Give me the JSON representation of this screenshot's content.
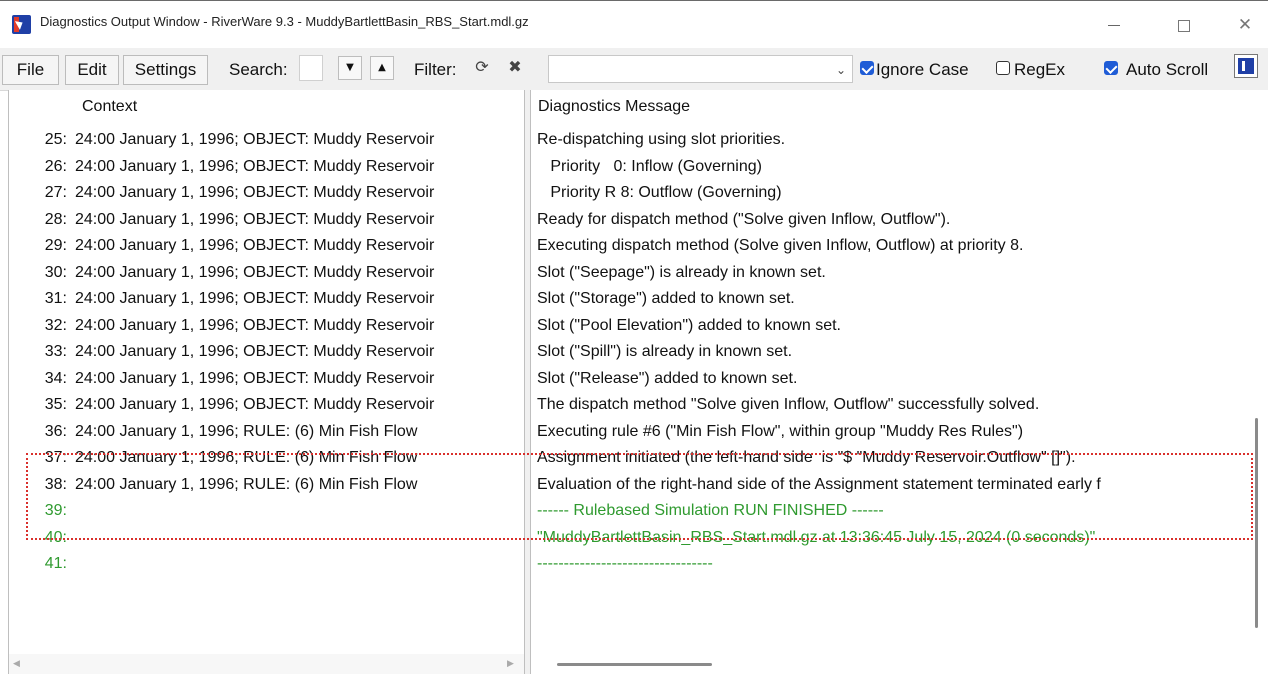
{
  "window": {
    "title": "Diagnostics Output Window - RiverWare 9.3 - MuddyBartlettBasin_RBS_Start.mdl.gz",
    "minimize_glyph": "",
    "maximize_glyph": "",
    "close_glyph": "✕"
  },
  "toolbar": {
    "file_label": "File",
    "edit_label": "Edit",
    "settings_label": "Settings",
    "search_label": "Search:",
    "search_value": "",
    "next_glyph": "▼",
    "prev_glyph": "▲",
    "filter_label": "Filter:",
    "refresh_glyph": "⟳",
    "clear_glyph": "✖",
    "filter_value": "",
    "combo_arrow_glyph": "⌄",
    "ignore_case_label": "Ignore Case",
    "ignore_case_checked": true,
    "regex_label": "RegEx",
    "regex_checked": false,
    "auto_scroll_label": "Auto Scroll",
    "auto_scroll_checked": true
  },
  "columns": {
    "context": "Context",
    "message": "Diagnostics Message"
  },
  "rows": [
    {
      "num": "25:",
      "context": "24:00 January 1, 1996; OBJECT: Muddy Reservoir",
      "message": "Re-dispatching using slot priorities.",
      "green": false
    },
    {
      "num": "26:",
      "context": "24:00 January 1, 1996; OBJECT: Muddy Reservoir",
      "message": "   Priority   0: Inflow (Governing)",
      "green": false
    },
    {
      "num": "27:",
      "context": "24:00 January 1, 1996; OBJECT: Muddy Reservoir",
      "message": "   Priority R 8: Outflow (Governing)",
      "green": false
    },
    {
      "num": "28:",
      "context": "24:00 January 1, 1996; OBJECT: Muddy Reservoir",
      "message": "Ready for dispatch method (\"Solve given Inflow, Outflow\").",
      "green": false
    },
    {
      "num": "29:",
      "context": "24:00 January 1, 1996; OBJECT: Muddy Reservoir",
      "message": "Executing dispatch method (Solve given Inflow, Outflow) at priority 8.",
      "green": false
    },
    {
      "num": "30:",
      "context": "24:00 January 1, 1996; OBJECT: Muddy Reservoir",
      "message": "Slot (\"Seepage\") is already in known set.",
      "green": false
    },
    {
      "num": "31:",
      "context": "24:00 January 1, 1996; OBJECT: Muddy Reservoir",
      "message": "Slot (\"Storage\") added to known set.",
      "green": false
    },
    {
      "num": "32:",
      "context": "24:00 January 1, 1996; OBJECT: Muddy Reservoir",
      "message": "Slot (\"Pool Elevation\") added to known set.",
      "green": false
    },
    {
      "num": "33:",
      "context": "24:00 January 1, 1996; OBJECT: Muddy Reservoir",
      "message": "Slot (\"Spill\") is already in known set.",
      "green": false
    },
    {
      "num": "34:",
      "context": "24:00 January 1, 1996; OBJECT: Muddy Reservoir",
      "message": "Slot (\"Release\") added to known set.",
      "green": false
    },
    {
      "num": "35:",
      "context": "24:00 January 1, 1996; OBJECT: Muddy Reservoir",
      "message": "The dispatch method \"Solve given Inflow, Outflow\" successfully solved.",
      "green": false
    },
    {
      "num": "36:",
      "context": "24:00 January 1, 1996; RULE: (6) Min Fish Flow",
      "message": "Executing rule #6 (\"Min Fish Flow\", within group \"Muddy Res Rules\")",
      "green": false
    },
    {
      "num": "37:",
      "context": "24:00 January 1, 1996; RULE: (6) Min Fish Flow",
      "message": "Assignment initiated (the left-hand side  is \"$ \"Muddy Reservoir.Outflow\" []\").",
      "green": false
    },
    {
      "num": "38:",
      "context": "24:00 January 1, 1996; RULE: (6) Min Fish Flow",
      "message": "Evaluation of the right-hand side of the Assignment statement terminated early f",
      "green": false
    },
    {
      "num": "39:",
      "context": "",
      "message": "------ Rulebased Simulation RUN FINISHED ------",
      "green": true
    },
    {
      "num": "40:",
      "context": "",
      "message": "\"MuddyBartlettBasin_RBS_Start.mdl.gz at 13:36:45 July 15, 2024 (0 seconds)\"",
      "green": true
    },
    {
      "num": "41:",
      "context": "",
      "message": "---------------------------------",
      "green": true
    }
  ],
  "colors": {
    "accent": "#1f5cd6",
    "finished_text": "#2f9a2f",
    "highlight_box": "#d9302c"
  }
}
